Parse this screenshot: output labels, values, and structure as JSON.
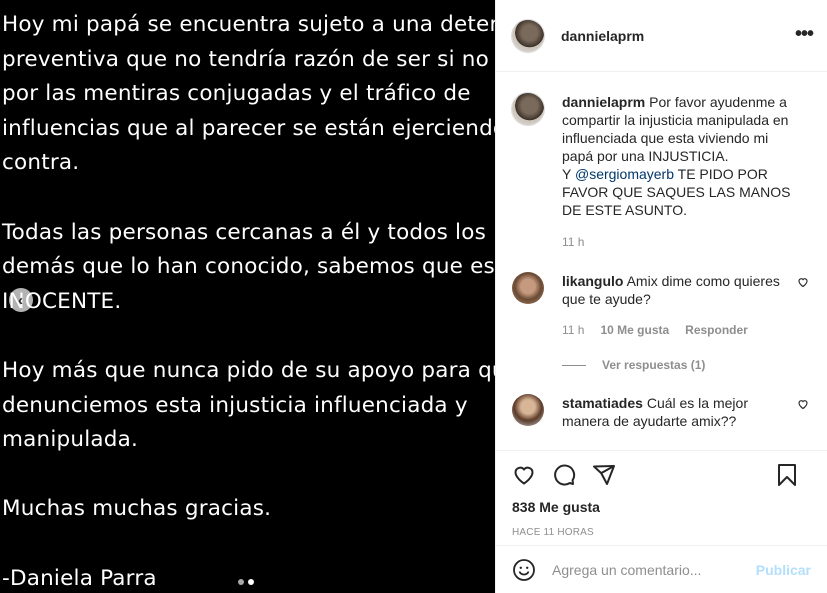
{
  "media": {
    "text": "Hoy mi papá se encuentra sujeto a una detención\npreventiva que no tendría razón de ser si no fuera\npor las mentiras conjugadas y el tráfico de\ninfluencias que al parecer se están ejerciendo en su\ncontra.\n\nTodas las personas cercanas a él y todos los\ndemás que lo han conocido, sabemos que es\nINOCENTE.\n\nHoy más que nunca pido de su apoyo para que\ndenunciemos esta injusticia influenciada y\nmanipulada.\n\nMuchas muchas gracias.\n\n-Daniela Parra",
    "prev_icon": "chevron-left-icon",
    "dots": [
      false,
      true
    ]
  },
  "header": {
    "username": "dannielaprm",
    "more_icon": "more-horizontal-icon"
  },
  "caption": {
    "username": "dannielaprm",
    "text_1": "Por favor ayudenme a compartir la injusticia manipulada en influenciada que esta viviendo mi papá por una INJUSTICIA.",
    "text_2_prefix": "Y ",
    "mention": "@sergiomayerb",
    "text_2_suffix": " TE PIDO POR FAVOR QUE SAQUES LAS MANOS DE ESTE ASUNTO.",
    "time": "11 h"
  },
  "comments": [
    {
      "username": "likangulo",
      "text": "Amix dime como quieres que te ayude?",
      "time": "11 h",
      "likes": "10 Me gusta",
      "reply": "Responder",
      "view_replies": "Ver respuestas (1)"
    },
    {
      "username": "stamatiades",
      "text": "Cuál es la mejor manera de ayudarte amix??"
    }
  ],
  "actions": {
    "likes": "838 Me gusta",
    "time_ago": "HACE 11 HORAS"
  },
  "add_comment": {
    "placeholder": "Agrega un comentario...",
    "publish": "Publicar"
  },
  "colors": {
    "link": "#00376b",
    "muted": "#8e8e8e",
    "publish_disabled": "#b2dffc"
  }
}
